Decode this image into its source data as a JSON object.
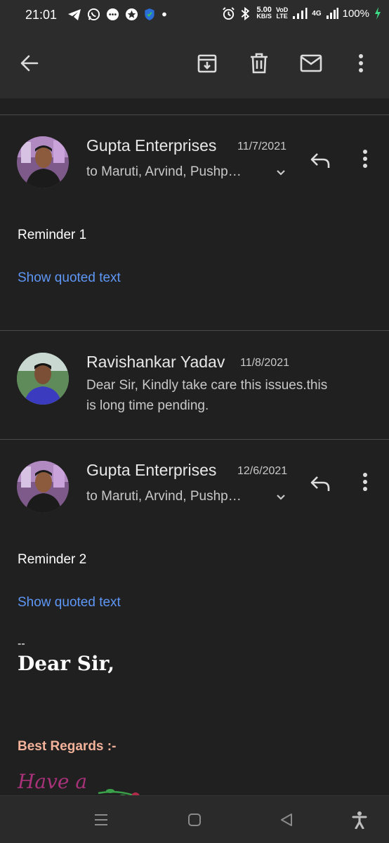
{
  "status_bar": {
    "time": "21:01",
    "speed_value": "5.00",
    "speed_unit": "KB/S",
    "volte_top": "VoD",
    "volte_bottom": "LTE",
    "network": "4G",
    "battery": "100%"
  },
  "thread": [
    {
      "sender": "Gupta Enterprises",
      "date": "11/7/2021",
      "recipients": "to Maruti, Arvind, Pushp…",
      "body": "Reminder 1",
      "quoted_link": "Show quoted text"
    },
    {
      "sender": "Ravishankar Yadav",
      "date": "11/8/2021",
      "snippet_line1": "Dear Sir, Kindly take care this issues.this",
      "snippet_line2": "is long time pending."
    },
    {
      "sender": "Gupta Enterprises",
      "date": "12/6/2021",
      "recipients": "to Maruti, Arvind, Pushp…",
      "body": "Reminder 2",
      "quoted_link": "Show quoted text",
      "signature_dash": "--",
      "signature_greeting": "Dear Sir,",
      "signature_regards": "Best Regards :-",
      "signature_art_text": "Have a"
    }
  ],
  "colors": {
    "background": "#202020",
    "toolbar": "#2c2c2c",
    "link": "#5e97f6",
    "regards": "#f3b29a"
  },
  "icons": [
    "back-arrow-icon",
    "archive-icon",
    "delete-icon",
    "mail-icon",
    "more-vert-icon",
    "reply-icon",
    "expand-chevron-icon",
    "recents-icon",
    "home-icon",
    "back-nav-icon",
    "accessibility-icon"
  ]
}
